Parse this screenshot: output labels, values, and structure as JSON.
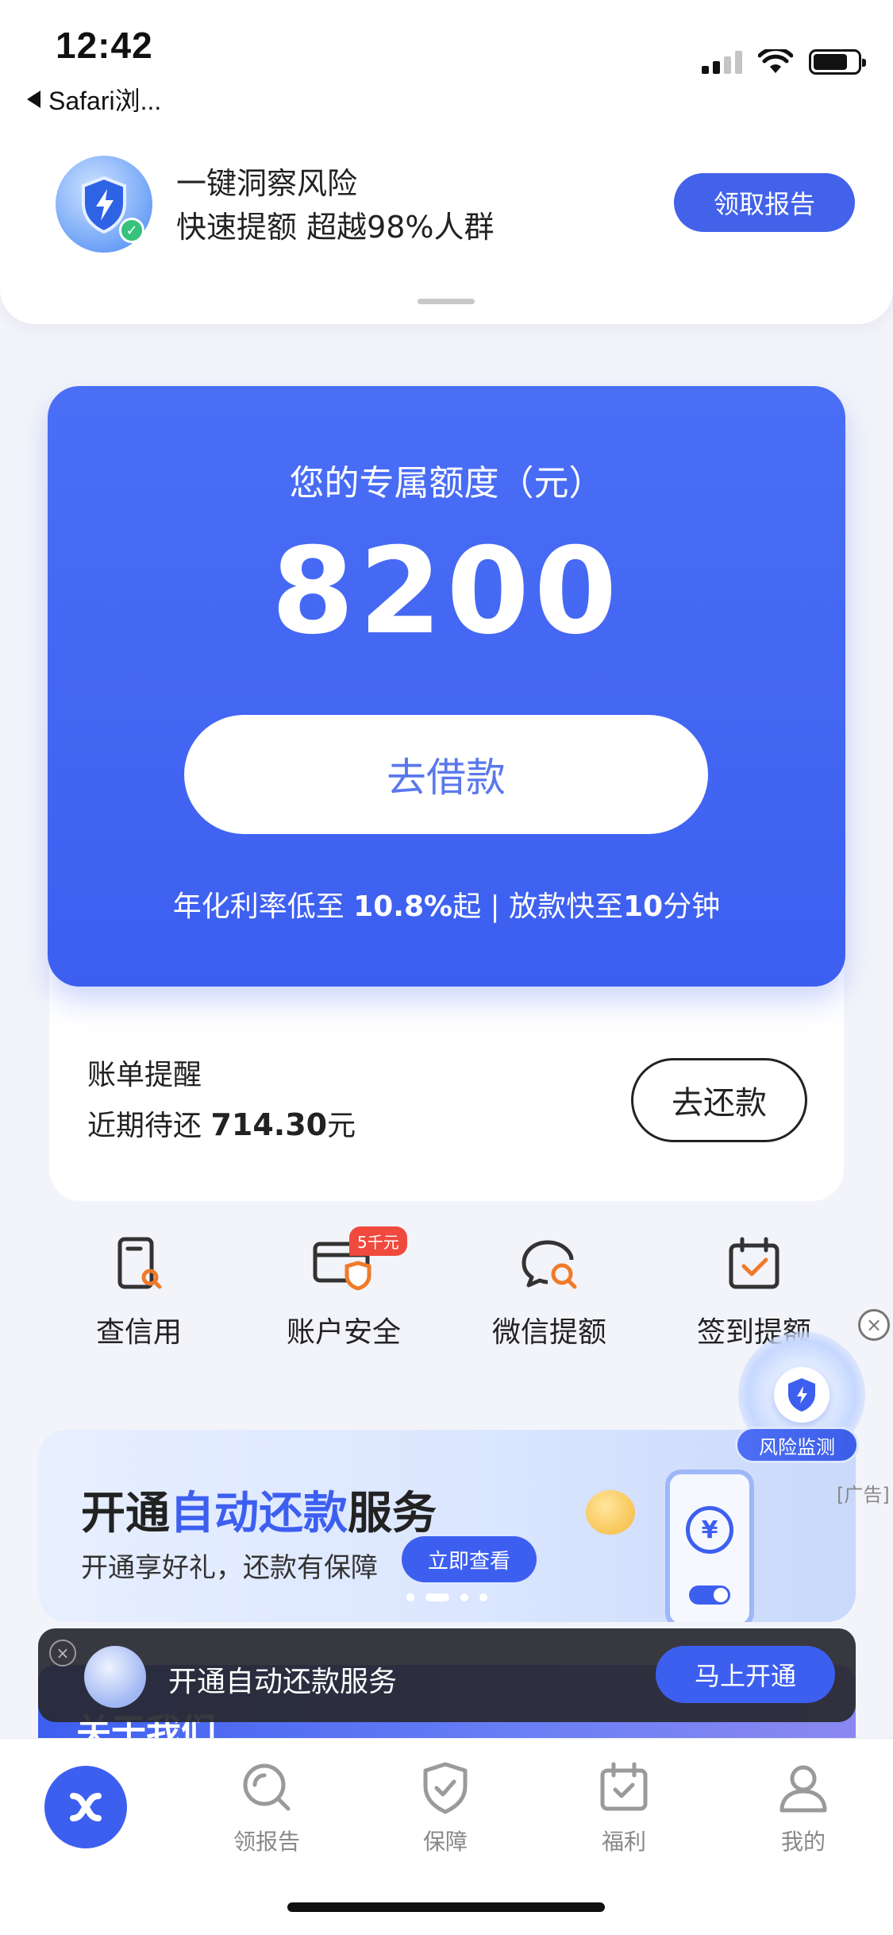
{
  "status_bar": {
    "time": "12:42",
    "back_label": "Safari浏..."
  },
  "top_promo": {
    "line1": "一键洞察风险",
    "line2": "快速提额 超越98%人群",
    "button": "领取报告"
  },
  "credit_card": {
    "title": "您的专属额度（元）",
    "amount": "8200",
    "button": "去借款",
    "note_prefix": "年化利率低至 ",
    "rate": "10.8%",
    "note_mid": "起 | 放款快至",
    "minutes": "10",
    "note_suffix": "分钟"
  },
  "bill": {
    "title": "账单提醒",
    "amount_prefix": "近期待还 ",
    "amount": "714.30",
    "amount_unit": "元",
    "button": "去还款"
  },
  "quick_actions": [
    {
      "label": "查信用",
      "icon": "credit-check-icon"
    },
    {
      "label": "账户安全",
      "icon": "account-security-icon",
      "badge": "5千元"
    },
    {
      "label": "微信提额",
      "icon": "wechat-raise-icon"
    },
    {
      "label": "签到提额",
      "icon": "checkin-calendar-icon"
    }
  ],
  "risk_widget": {
    "label": "风险监测",
    "ad_tag": "[广告]"
  },
  "ad_banner": {
    "title_pre": "开通",
    "title_hl": "自动还款",
    "title_post": "服务",
    "subtitle": "开通享好礼，还款有保障",
    "button": "立即查看",
    "pages": 4,
    "active_page": 2
  },
  "toast": {
    "text": "开通自动还款服务",
    "button": "马上开通"
  },
  "about": {
    "title": "关于我们"
  },
  "tabbar": [
    {
      "label": "",
      "icon": "home-logo-icon"
    },
    {
      "label": "领报告",
      "icon": "search-report-icon"
    },
    {
      "label": "保障",
      "icon": "shield-check-icon"
    },
    {
      "label": "福利",
      "icon": "calendar-check-icon"
    },
    {
      "label": "我的",
      "icon": "user-icon"
    }
  ],
  "colors": {
    "accent": "#3d5ff0",
    "badge": "#f04a3f",
    "quick_icon_accent": "#f07a2a"
  }
}
